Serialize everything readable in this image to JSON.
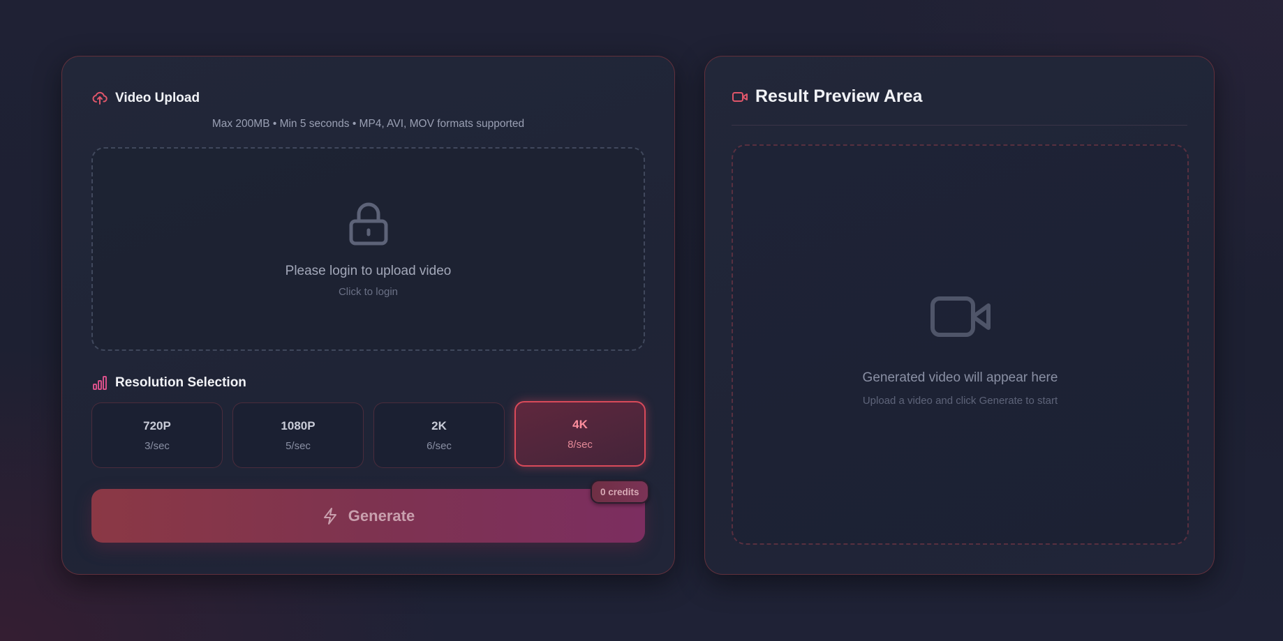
{
  "upload": {
    "title": "Video Upload",
    "title_icon": "cloud-upload-icon",
    "hint": "Max 200MB • Min 5 seconds • MP4, AVI, MOV formats supported",
    "dropzone": {
      "icon": "lock-icon",
      "message": "Please login to upload video",
      "sub_message": "Click to login"
    }
  },
  "resolution": {
    "title": "Resolution Selection",
    "title_icon": "bar-chart-icon",
    "options": [
      {
        "label": "720P",
        "rate": "3/sec",
        "selected": false
      },
      {
        "label": "1080P",
        "rate": "5/sec",
        "selected": false
      },
      {
        "label": "2K",
        "rate": "6/sec",
        "selected": false
      },
      {
        "label": "4K",
        "rate": "8/sec",
        "selected": true
      }
    ]
  },
  "generate": {
    "label": "Generate",
    "icon": "lightning-icon",
    "credits": "0 credits"
  },
  "result": {
    "title": "Result Preview Area",
    "title_icon": "video-camera-icon",
    "placeholder_icon": "video-camera-icon",
    "message": "Generated video will appear here",
    "sub_message": "Upload a video and click Generate to start"
  },
  "colors": {
    "accent": "#e0566a",
    "accent_pink": "#d9508a",
    "panel_border": "#78343e",
    "background": "#1f2134"
  }
}
